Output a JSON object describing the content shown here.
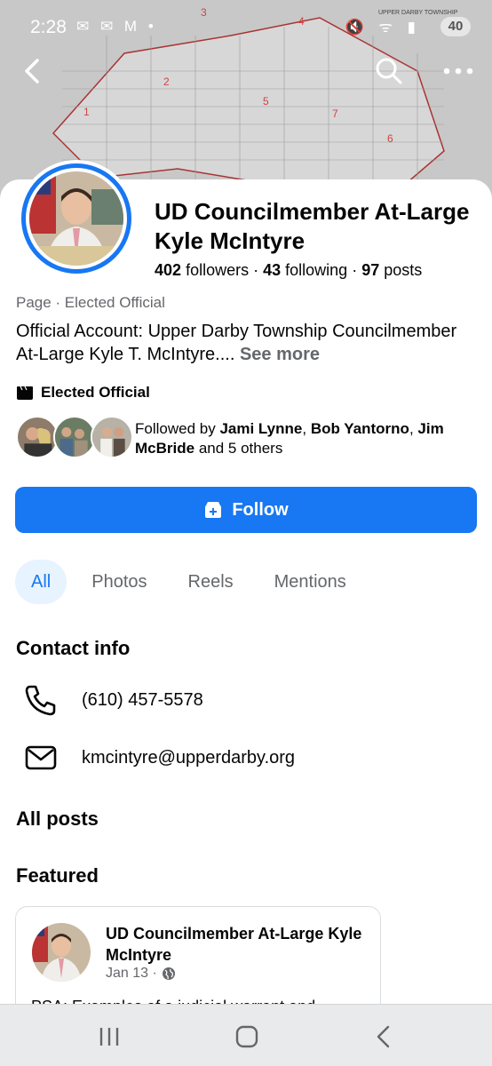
{
  "status_bar": {
    "time": "2:28",
    "left_icons": "✉ ✉ M •",
    "right_icons": "🔇 ᯤ ▮",
    "battery": "40",
    "map_label": "UPPER DARBY TOWNSHIP"
  },
  "profile": {
    "name": "UD Councilmember At-Large Kyle McIntyre",
    "followers_count": "402",
    "followers_label": "followers",
    "following_count": "43",
    "following_label": "following",
    "posts_count": "97",
    "posts_label": "posts",
    "category": "Page · Elected Official",
    "bio": "Official Account: Upper Darby Township Councilmember At-Large Kyle T. McIntyre....",
    "see_more": "See more",
    "badge": "Elected Official",
    "followed_by_prefix": "Followed by",
    "followed_by_names": [
      "Jami Lynne",
      "Bob Yantorno",
      "Jim McBride"
    ],
    "followed_by_suffix": "and 5 others"
  },
  "actions": {
    "follow": "Follow"
  },
  "tabs": [
    {
      "label": "All",
      "active": true
    },
    {
      "label": "Photos",
      "active": false
    },
    {
      "label": "Reels",
      "active": false
    },
    {
      "label": "Mentions",
      "active": false
    }
  ],
  "contact": {
    "heading": "Contact info",
    "phone": "(610) 457-5578",
    "email": "kmcintyre@upperdarby.org"
  },
  "sections": {
    "all_posts": "All posts",
    "featured": "Featured"
  },
  "featured_post": {
    "author": "UD Councilmember At-Large Kyle McIntyre",
    "date": "Jan 13 ·",
    "text": "PSA: Examples of a judicial warrant and"
  },
  "colors": {
    "accent": "#1877f2",
    "tab_active_bg": "#e7f3ff",
    "secondary_text": "#65676b"
  }
}
